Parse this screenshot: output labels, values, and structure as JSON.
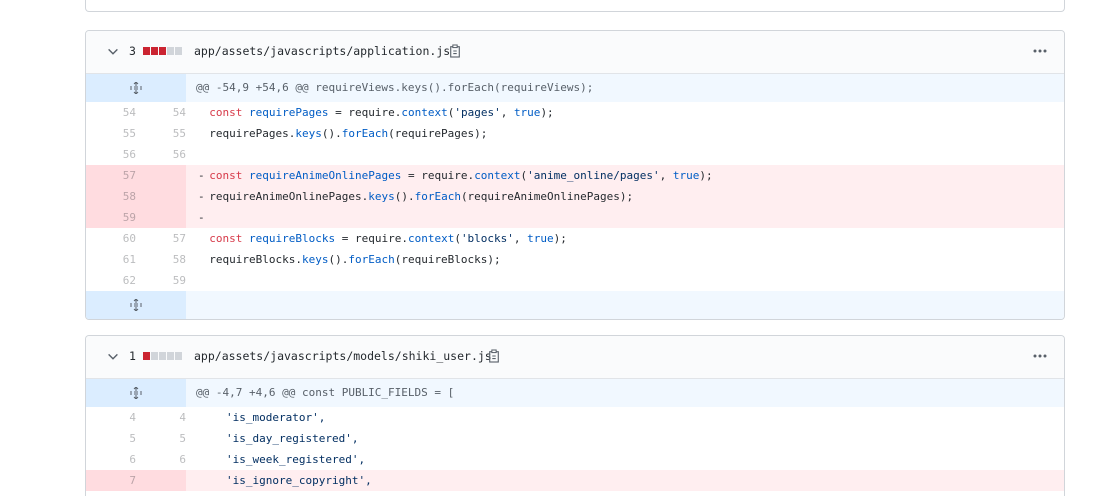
{
  "files": [
    {
      "change_count": "3",
      "blocks": [
        "del",
        "del",
        "del",
        "neutral",
        "neutral"
      ],
      "filename": "app/assets/javascripts/application.js",
      "hunk_header": "@@ -54,9 +54,6 @@ requireViews.keys().forEach(requireViews);",
      "lines": [
        {
          "type": "ctx",
          "old": "54",
          "new": "54"
        },
        {
          "type": "ctx",
          "old": "55",
          "new": "55"
        },
        {
          "type": "ctx",
          "old": "56",
          "new": "56"
        },
        {
          "type": "del",
          "old": "57",
          "new": ""
        },
        {
          "type": "del",
          "old": "58",
          "new": ""
        },
        {
          "type": "del",
          "old": "59",
          "new": ""
        },
        {
          "type": "ctx",
          "old": "60",
          "new": "57"
        },
        {
          "type": "ctx",
          "old": "61",
          "new": "58"
        },
        {
          "type": "ctx",
          "old": "62",
          "new": "59"
        }
      ],
      "code": {
        "l1": {
          "a": "const",
          "b": "requirePages",
          "c": " = require.",
          "d": "context",
          "e": "(",
          "f": "'pages'",
          "g": ", ",
          "h": "true",
          "i": ");"
        },
        "l2": {
          "a": "requirePages.",
          "b": "keys",
          "c": "().",
          "d": "forEach",
          "e": "(requirePages);"
        },
        "l4": {
          "a": "const",
          "b": "requireAnimeOnlinePages",
          "c": " = require.",
          "d": "context",
          "e": "(",
          "f": "'anime_online/pages'",
          "g": ", ",
          "h": "true",
          "i": ");"
        },
        "l5": {
          "a": "requireAnimeOnlinePages.",
          "b": "keys",
          "c": "().",
          "d": "forEach",
          "e": "(requireAnimeOnlinePages);"
        },
        "l7": {
          "a": "const",
          "b": "requireBlocks",
          "c": " = require.",
          "d": "context",
          "e": "(",
          "f": "'blocks'",
          "g": ", ",
          "h": "true",
          "i": ");"
        },
        "l8": {
          "a": "requireBlocks.",
          "b": "keys",
          "c": "().",
          "d": "forEach",
          "e": "(requireBlocks);"
        }
      }
    },
    {
      "change_count": "1",
      "blocks": [
        "del",
        "neutral",
        "neutral",
        "neutral",
        "neutral"
      ],
      "filename": "app/assets/javascripts/models/shiki_user.js",
      "hunk_header": "@@ -4,7 +4,6 @@ const PUBLIC_FIELDS = [",
      "lines": [
        {
          "type": "ctx",
          "old": "4",
          "new": "4",
          "text": "'is_moderator',"
        },
        {
          "type": "ctx",
          "old": "5",
          "new": "5",
          "text": "'is_day_registered',"
        },
        {
          "type": "ctx",
          "old": "6",
          "new": "6",
          "text": "'is_week_registered',"
        },
        {
          "type": "del",
          "old": "7",
          "new": "",
          "text": "'is_ignore_copyright',"
        }
      ]
    }
  ],
  "signs": {
    "minus": "-"
  },
  "icons": {
    "chevron": "chevron-down-icon",
    "copy": "clipboard-icon",
    "more": "kebab-horizontal-icon",
    "expand": "unfold-icon"
  },
  "colors": {
    "deletion": "#cb2431",
    "deletion_bg": "#ffeef0",
    "hunk_bg": "#f1f8ff",
    "keyword": "#d73a49",
    "entity": "#005cc5",
    "string": "#032f62"
  }
}
